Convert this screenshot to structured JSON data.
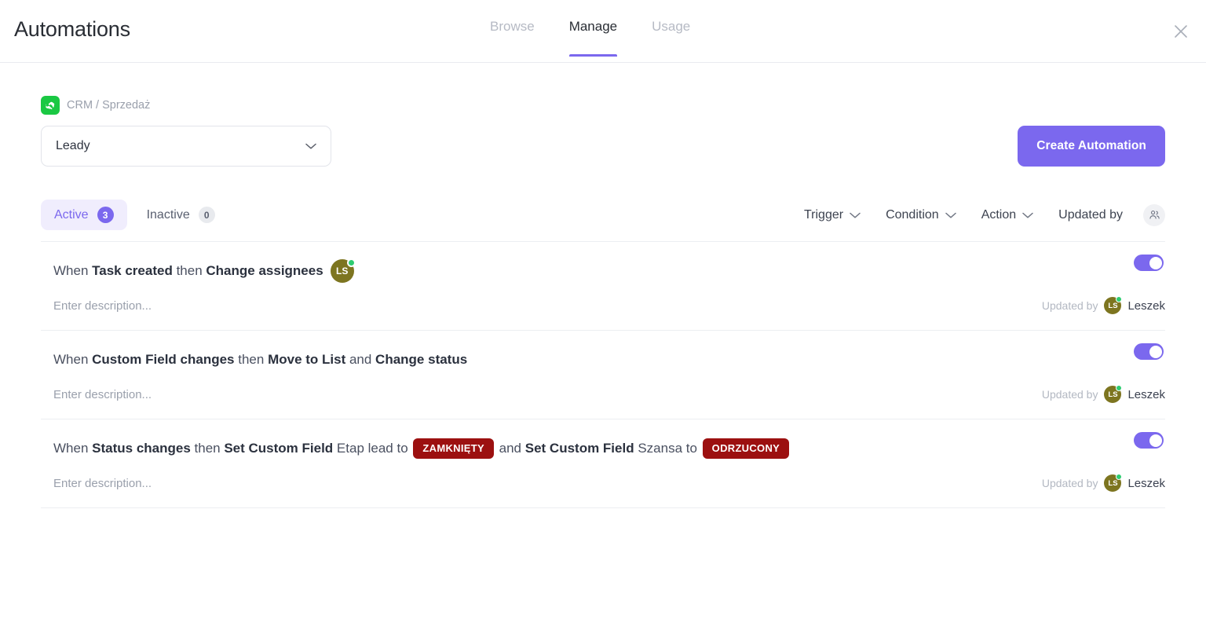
{
  "header": {
    "title": "Automations",
    "tabs": [
      {
        "label": "Browse",
        "active": false
      },
      {
        "label": "Manage",
        "active": true
      },
      {
        "label": "Usage",
        "active": false
      }
    ],
    "close_icon": "close-icon"
  },
  "breadcrumb": {
    "space_icon": "handshake-icon",
    "space_color": "#26c44b",
    "text": "CRM / Sprzedaż"
  },
  "list_select": {
    "value": "Leady",
    "chevron_icon": "chevron-down-icon"
  },
  "create_button": {
    "label": "Create Automation",
    "color": "#7b68ee"
  },
  "status_tabs": [
    {
      "label": "Active",
      "count": "3",
      "selected": true
    },
    {
      "label": "Inactive",
      "count": "0",
      "selected": false
    }
  ],
  "filters": [
    {
      "label": "Trigger",
      "icon": "chevron-down-icon"
    },
    {
      "label": "Condition",
      "icon": "chevron-down-icon"
    },
    {
      "label": "Action",
      "icon": "chevron-down-icon"
    }
  ],
  "updated_by_filter": {
    "label": "Updated by",
    "icon": "people-icon"
  },
  "automations": [
    {
      "parts": [
        {
          "t": "When ",
          "style": "light"
        },
        {
          "t": "Task created",
          "style": "bold"
        },
        {
          "t": " then ",
          "style": "light"
        },
        {
          "t": "Change assignees",
          "style": "bold"
        }
      ],
      "avatar": {
        "initials": "LS",
        "color": "#7d7520",
        "online": true
      },
      "description_placeholder": "Enter description...",
      "updated_by_label": "Updated by",
      "updated_by_name": "Leszek",
      "enabled": true
    },
    {
      "parts": [
        {
          "t": "When ",
          "style": "light"
        },
        {
          "t": "Custom Field changes",
          "style": "bold"
        },
        {
          "t": " then ",
          "style": "light"
        },
        {
          "t": "Move to List",
          "style": "bold"
        },
        {
          "t": " and ",
          "style": "light"
        },
        {
          "t": "Change status",
          "style": "bold"
        }
      ],
      "avatar": null,
      "description_placeholder": "Enter description...",
      "updated_by_label": "Updated by",
      "updated_by_name": "Leszek",
      "enabled": true
    },
    {
      "parts": [
        {
          "t": "When ",
          "style": "light"
        },
        {
          "t": "Status changes",
          "style": "bold"
        },
        {
          "t": " then ",
          "style": "light"
        },
        {
          "t": "Set Custom Field",
          "style": "bold"
        },
        {
          "t": " Etap lead to ",
          "style": "light"
        },
        {
          "t": "ZAMKNIĘTY",
          "style": "badge",
          "color": "#9c1010"
        },
        {
          "t": " and ",
          "style": "light"
        },
        {
          "t": "Set Custom Field",
          "style": "bold"
        },
        {
          "t": " Szansa to ",
          "style": "light"
        },
        {
          "t": "ODRZUCONY",
          "style": "badge",
          "color": "#9c1010"
        }
      ],
      "avatar": null,
      "description_placeholder": "Enter description...",
      "updated_by_label": "Updated by",
      "updated_by_name": "Leszek",
      "enabled": true
    }
  ]
}
